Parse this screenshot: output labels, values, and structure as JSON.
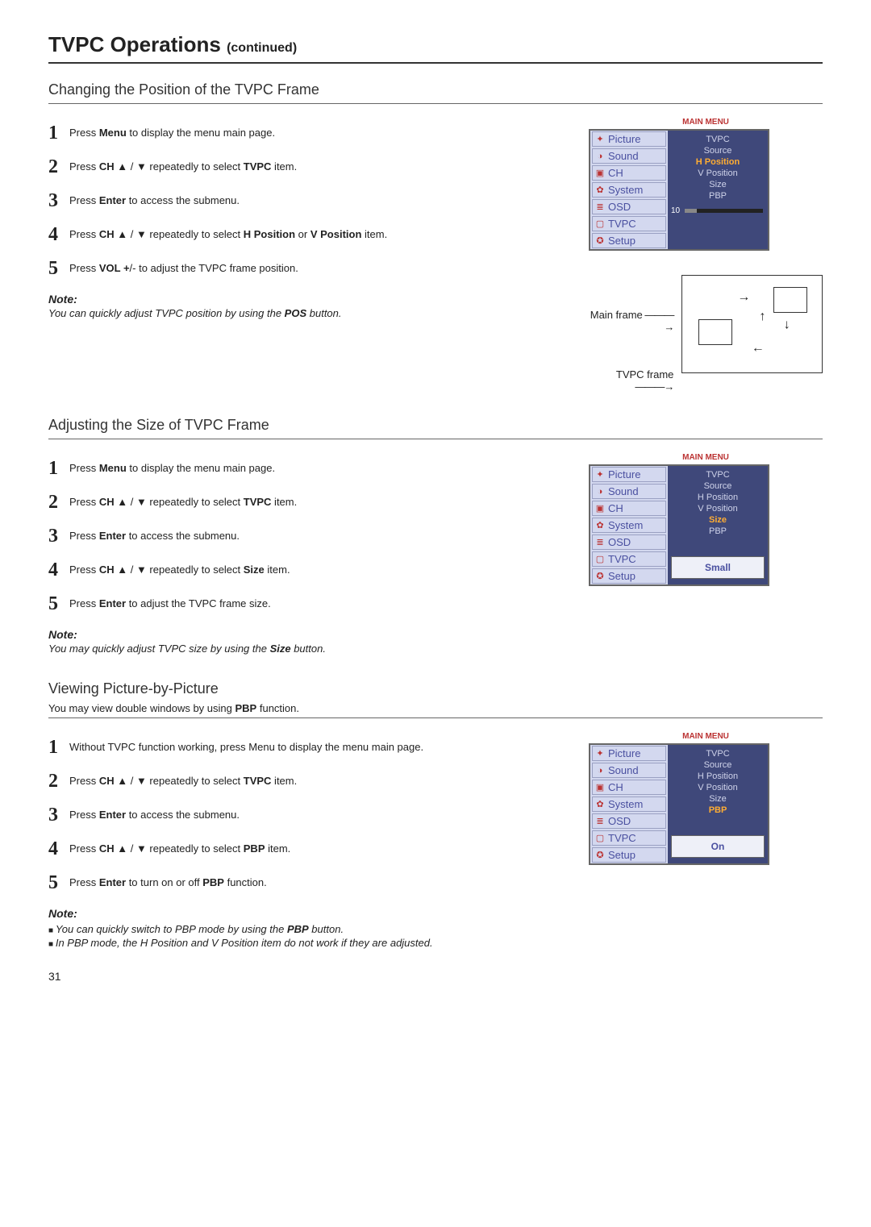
{
  "page": {
    "title": "TVPC Operations",
    "title_cont": "(continued)",
    "number": "31"
  },
  "section1": {
    "heading": "Changing the Position of the TVPC Frame",
    "steps": [
      "Press <b>Menu</b> to display the menu main page.",
      "Press <b>CH</b> ▲ / ▼ repeatedly to select <b>TVPC</b> item.",
      "Press <b>Enter</b> to access the submenu.",
      "Press <b>CH</b> ▲ / ▼ repeatedly to select <b>H Position</b> or <b>V Position</b> item.",
      "Press <b>VOL +</b>/- to adjust the TVPC frame position."
    ],
    "note_label": "Note:",
    "note": "You can quickly adjust TVPC position by using the <b>POS</b> button.",
    "frame_labels": {
      "main": "Main frame",
      "tvpc": "TVPC frame"
    },
    "menu": {
      "header": "MAIN MENU",
      "items": [
        "Picture",
        "Sound",
        "CH",
        "System",
        "OSD",
        "TVPC",
        "Setup"
      ],
      "submenu": [
        "TVPC",
        "Source",
        "H Position",
        "V Position",
        "Size",
        "PBP"
      ],
      "highlight": "H Position",
      "slider_value": "10"
    }
  },
  "section2": {
    "heading": "Adjusting the Size of TVPC Frame",
    "steps": [
      "Press <b>Menu</b> to display the menu main page.",
      "Press <b>CH</b> ▲ / ▼ repeatedly to select <b>TVPC</b> item.",
      "Press <b>Enter</b> to access the submenu.",
      "Press <b>CH</b> ▲ / ▼ repeatedly to select <b>Size</b> item.",
      "Press <b>Enter</b> to adjust the TVPC frame size."
    ],
    "note_label": "Note:",
    "note": "You may quickly adjust TVPC size by using the <b>Size</b> button.",
    "menu": {
      "header": "MAIN MENU",
      "items": [
        "Picture",
        "Sound",
        "CH",
        "System",
        "OSD",
        "TVPC",
        "Setup"
      ],
      "submenu": [
        "TVPC",
        "Source",
        "H Position",
        "V Position",
        "Size",
        "PBP"
      ],
      "highlight": "Size",
      "result": "Small"
    }
  },
  "section3": {
    "heading": "Viewing Picture-by-Picture",
    "intro": "You may view double windows by using <b>PBP</b> function.",
    "steps": [
      "Without TVPC function working, press  Menu to display the menu main page.",
      "Press <b>CH</b> ▲ / ▼ repeatedly to select <b>TVPC</b> item.",
      "Press <b>Enter</b> to access the submenu.",
      "Press <b>CH</b> ▲ / ▼ repeatedly to select <b>PBP</b> item.",
      "Press <b>Enter</b> to turn on or off  <b>PBP</b> function."
    ],
    "note_label": "Note:",
    "notes": [
      "You can quickly switch to PBP mode by using the <b>PBP</b> button.",
      "In PBP mode, the H Position and V Position item do not work if they are adjusted."
    ],
    "menu": {
      "header": "MAIN MENU",
      "items": [
        "Picture",
        "Sound",
        "CH",
        "System",
        "OSD",
        "TVPC",
        "Setup"
      ],
      "submenu": [
        "TVPC",
        "Source",
        "H Position",
        "V Position",
        "Size",
        "PBP"
      ],
      "highlight": "PBP",
      "result": "On"
    }
  },
  "icons": [
    "✦",
    "◑",
    "▣",
    "✿",
    "≣",
    "▢",
    "✪"
  ]
}
